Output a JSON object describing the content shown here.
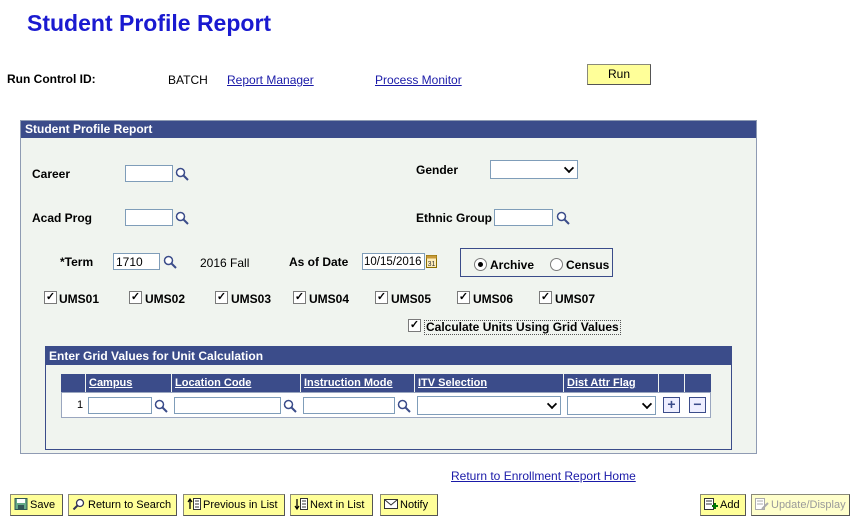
{
  "page_title": "Student Profile Report",
  "run_control": {
    "label": "Run Control ID:",
    "value": "BATCH",
    "report_manager": "Report Manager",
    "process_monitor": "Process Monitor",
    "run_label": "Run"
  },
  "panel": {
    "header": "Student Profile Report",
    "career_label": "Career",
    "career_value": "",
    "acad_prog_label": "Acad Prog",
    "acad_prog_value": "",
    "gender_label": "Gender",
    "gender_value": "",
    "ethnic_group_label": "Ethnic Group",
    "ethnic_group_value": "",
    "term_label": "*Term",
    "term_value": "1710",
    "term_desc": "2016 Fall",
    "as_of_date_label": "As of Date",
    "as_of_date_value": "10/15/2016",
    "archive_label": "Archive",
    "census_label": "Census",
    "selected_mode": "Archive",
    "campuses": [
      {
        "label": "UMS01",
        "checked": true
      },
      {
        "label": "UMS02",
        "checked": true
      },
      {
        "label": "UMS03",
        "checked": true
      },
      {
        "label": "UMS04",
        "checked": true
      },
      {
        "label": "UMS05",
        "checked": true
      },
      {
        "label": "UMS06",
        "checked": true
      },
      {
        "label": "UMS07",
        "checked": true
      }
    ],
    "calc_units_label": "Calculate Units Using Grid Values",
    "calc_units_checked": true
  },
  "grid": {
    "header": "Enter Grid Values for Unit Calculation",
    "columns": [
      "Campus",
      "Location Code",
      "Instruction Mode",
      "ITV Selection",
      "Dist Attr Flag"
    ],
    "row_number": "1"
  },
  "return_link": "Return to Enrollment Report Home",
  "toolbar": {
    "save": "Save",
    "return_to_search": "Return to Search",
    "previous_in_list": "Previous in List",
    "next_in_list": "Next in List",
    "notify": "Notify",
    "add": "Add",
    "update_display": "Update/Display"
  },
  "colors": {
    "title": "#1a1ad0",
    "header_bar": "#3b4c8a",
    "panel_bg": "#f0f4ef",
    "button_bg": "#ffff99",
    "link": "#1a1aa8"
  }
}
